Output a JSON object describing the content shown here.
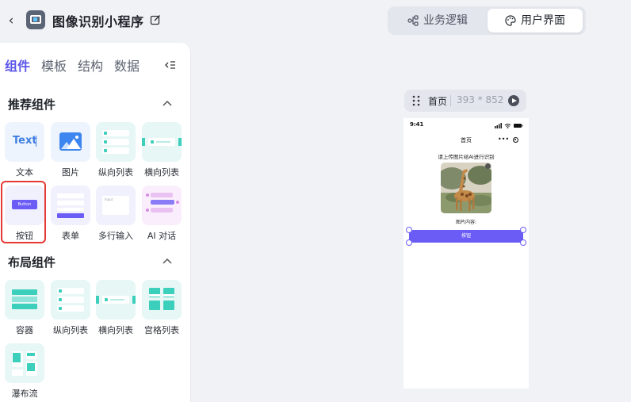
{
  "header": {
    "back_glyph": "‹",
    "app_title": "图像识别小程序",
    "modes": [
      {
        "label": "业务逻辑",
        "icon": "flow-icon"
      },
      {
        "label": "用户界面",
        "icon": "palette-icon"
      }
    ],
    "active_mode": "用户界面"
  },
  "sidebar": {
    "tabs": [
      "组件",
      "模板",
      "结构",
      "数据"
    ],
    "active_tab": "组件",
    "sections": [
      {
        "title": "推荐组件",
        "items": [
          {
            "label": "文本",
            "icon": "text-icon",
            "preview_text": "Text"
          },
          {
            "label": "图片",
            "icon": "image-icon"
          },
          {
            "label": "纵向列表",
            "icon": "vertical-list-icon"
          },
          {
            "label": "横向列表",
            "icon": "horizontal-list-icon"
          },
          {
            "label": "按钮",
            "icon": "button-icon",
            "preview_text": "Button",
            "selected": true
          },
          {
            "label": "表单",
            "icon": "form-icon"
          },
          {
            "label": "多行输入",
            "icon": "textarea-icon",
            "preview_text": "Input"
          },
          {
            "label": "AI 对话",
            "icon": "ai-chat-icon"
          }
        ]
      },
      {
        "title": "布局组件",
        "items": [
          {
            "label": "容器",
            "icon": "container-icon"
          },
          {
            "label": "纵向列表",
            "icon": "vertical-list-icon"
          },
          {
            "label": "横向列表",
            "icon": "horizontal-list-icon"
          },
          {
            "label": "宫格列表",
            "icon": "grid-list-icon"
          },
          {
            "label": "瀑布流",
            "icon": "waterfall-icon"
          }
        ]
      }
    ],
    "highlight_color": "#e53935"
  },
  "canvas": {
    "page_name": "首页",
    "page_size": "393 * 852"
  },
  "phone": {
    "time": "9:41",
    "nav_title": "首页",
    "prompt": "请上传图片给AI进行识别",
    "content_label": "图片内容:",
    "button_label": "按钮",
    "button_color": "#6b5cf6"
  },
  "colors": {
    "accent": "#5b54e8",
    "panel_bg": "#ffffff",
    "app_bg": "#f1f2f6"
  }
}
